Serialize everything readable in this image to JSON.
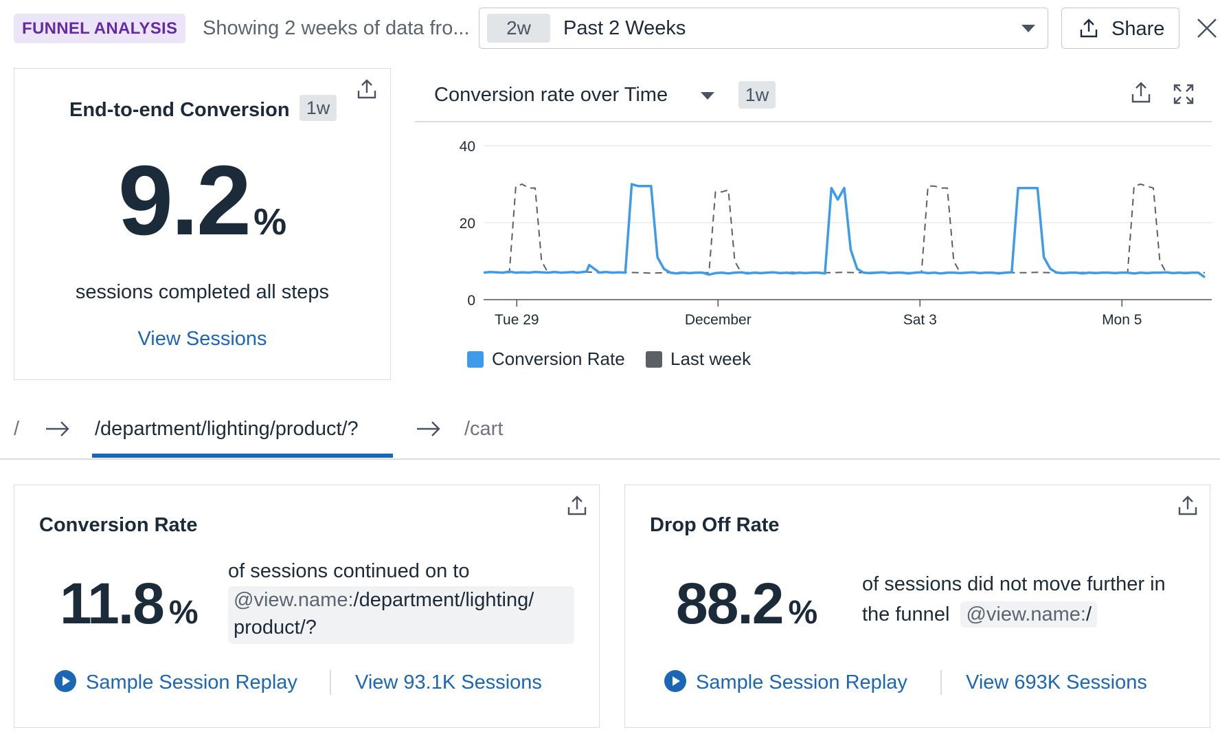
{
  "header": {
    "badge": "FUNNEL ANALYSIS",
    "subtitle": "Showing 2 weeks of data fro...",
    "timeframe_chip": "2w",
    "timeframe_label": "Past 2 Weeks",
    "share_label": "Share"
  },
  "end_to_end": {
    "title": "End-to-end Conversion",
    "chip": "1w",
    "value": "9.2",
    "unit": "%",
    "subtitle": "sessions completed all steps",
    "link": "View Sessions"
  },
  "chart_panel": {
    "title": "Conversion rate over Time",
    "chip": "1w"
  },
  "chart_data": {
    "type": "line",
    "yticks": [
      "0",
      "20",
      "40"
    ],
    "ylim": [
      0,
      40
    ],
    "xticks": [
      "Tue 29",
      "December",
      "Sat 3",
      "Mon 5"
    ],
    "grid": true,
    "legend_position": "bottom-left",
    "series": [
      {
        "name": "Conversion Rate",
        "color": "#3d9be9",
        "x": [
          0,
          0.5,
          1,
          1.5,
          2,
          2.5,
          3,
          3.5,
          4,
          4.5,
          5,
          5.5,
          6,
          6.5,
          7,
          7.2,
          7.5,
          8,
          8.2,
          9,
          9.2,
          9.5,
          10,
          10.5,
          11,
          11.5,
          12,
          12.5,
          13,
          13.5,
          14,
          14.5,
          15,
          15.5,
          16,
          16.5,
          17,
          17.5,
          18,
          18.5,
          19,
          19.5,
          20,
          20.5,
          21,
          21.5,
          22,
          22.5,
          23,
          23.5,
          24,
          24.5,
          25,
          25.5,
          26,
          26.5,
          27,
          27.5,
          28,
          28.5,
          29,
          29.5,
          30,
          30.5,
          31,
          31.5,
          32,
          32.5,
          33,
          33.5,
          34,
          34.5,
          35,
          35.5,
          36,
          36.5,
          37,
          37.5,
          38,
          38.5,
          39,
          39.5,
          40,
          40.5,
          41,
          41.5,
          42,
          42.5,
          43,
          43.5,
          44,
          44.5,
          45,
          45.5,
          46,
          46.5,
          47,
          47.5,
          48,
          48.5,
          49,
          49.5,
          50,
          50.5,
          51,
          51.5,
          52,
          52.5,
          53,
          53.5,
          54,
          54.5,
          55,
          55.5,
          56
        ],
        "y": [
          7,
          7.2,
          7.1,
          7,
          7.3,
          7,
          7.1,
          7,
          7.2,
          7.1,
          7,
          7.2,
          7,
          7.1,
          7.2,
          7,
          7.1,
          7.3,
          9,
          7,
          7.1,
          7.2,
          7,
          7.1,
          7,
          30,
          29.5,
          29.5,
          29.5,
          11,
          8,
          7,
          6.8,
          7,
          6.9,
          7,
          7,
          6.5,
          6.9,
          7,
          6.8,
          7,
          7.1,
          6.8,
          7,
          6.9,
          7,
          7.1,
          6.9,
          7,
          6.8,
          7,
          6.9,
          7,
          7,
          6.8,
          29,
          26,
          29,
          13,
          8,
          7,
          6.9,
          7,
          7.1,
          6.9,
          7,
          7,
          6.8,
          7,
          7.1,
          6.9,
          7,
          6.8,
          7,
          7,
          6.9,
          7,
          7.1,
          6.9,
          7,
          7,
          6.8,
          7,
          7.1,
          29,
          29,
          29,
          29,
          11,
          8,
          7,
          6.9,
          7,
          7,
          6.8,
          7,
          6.9,
          7,
          7,
          6.9,
          7,
          7,
          6.8,
          7,
          6.9,
          7,
          7,
          7.1,
          6.9,
          7,
          6.9,
          7,
          7,
          5.8
        ]
      },
      {
        "name": "Last week",
        "color": "#5c5f66",
        "dashed": true,
        "x": [
          0,
          1,
          2,
          2.5,
          3,
          3.5,
          4,
          4.5,
          5,
          6,
          7,
          8,
          9,
          10,
          11,
          12,
          13,
          14,
          15,
          16,
          17,
          17.5,
          18,
          18.5,
          19,
          19.5,
          20,
          21,
          22,
          23,
          24,
          25,
          26,
          27,
          28,
          29,
          30,
          31,
          32,
          33,
          34,
          34.5,
          35,
          35.5,
          36,
          36.5,
          37,
          38,
          39,
          40,
          41,
          42,
          43,
          44,
          45,
          46,
          47,
          48,
          49,
          50,
          50.5,
          51,
          51.5,
          52,
          52.5,
          53,
          54,
          55,
          56
        ],
        "y": [
          7,
          7.1,
          7,
          29.5,
          30,
          29,
          29,
          10,
          7,
          7.1,
          7,
          7.2,
          7,
          7,
          7.1,
          7,
          6.9,
          7,
          7.1,
          7,
          7,
          7,
          28,
          28,
          28.5,
          10,
          7,
          7.1,
          7,
          7,
          7.1,
          7,
          7,
          7,
          7.1,
          7,
          7.1,
          7,
          7,
          7,
          7,
          29.5,
          29.5,
          29,
          29,
          10,
          7,
          7,
          7.1,
          7,
          7,
          7,
          7.1,
          7,
          7,
          7,
          7.1,
          7,
          7,
          7,
          29.5,
          30,
          29.5,
          29,
          10,
          7,
          7,
          7.1,
          7
        ]
      }
    ]
  },
  "steps": [
    "/",
    "/department/lighting/product/?",
    "/cart"
  ],
  "conversion_card": {
    "title": "Conversion Rate",
    "value": "11.8",
    "unit": "%",
    "text": "of sessions continued on to",
    "tag_key": "@view.name:",
    "tag_value_1": "/department/lighting/",
    "tag_value_2": "product/?",
    "replay_label": "Sample Session Replay",
    "view_label": "View 93.1K Sessions"
  },
  "drop_card": {
    "title": "Drop Off Rate",
    "value": "88.2",
    "unit": "%",
    "text_1": "of sessions did not move further in",
    "text_2": "the funnel",
    "tag_key": "@view.name:",
    "tag_value": "/",
    "replay_label": "Sample Session Replay",
    "view_label": "View 693K Sessions"
  }
}
